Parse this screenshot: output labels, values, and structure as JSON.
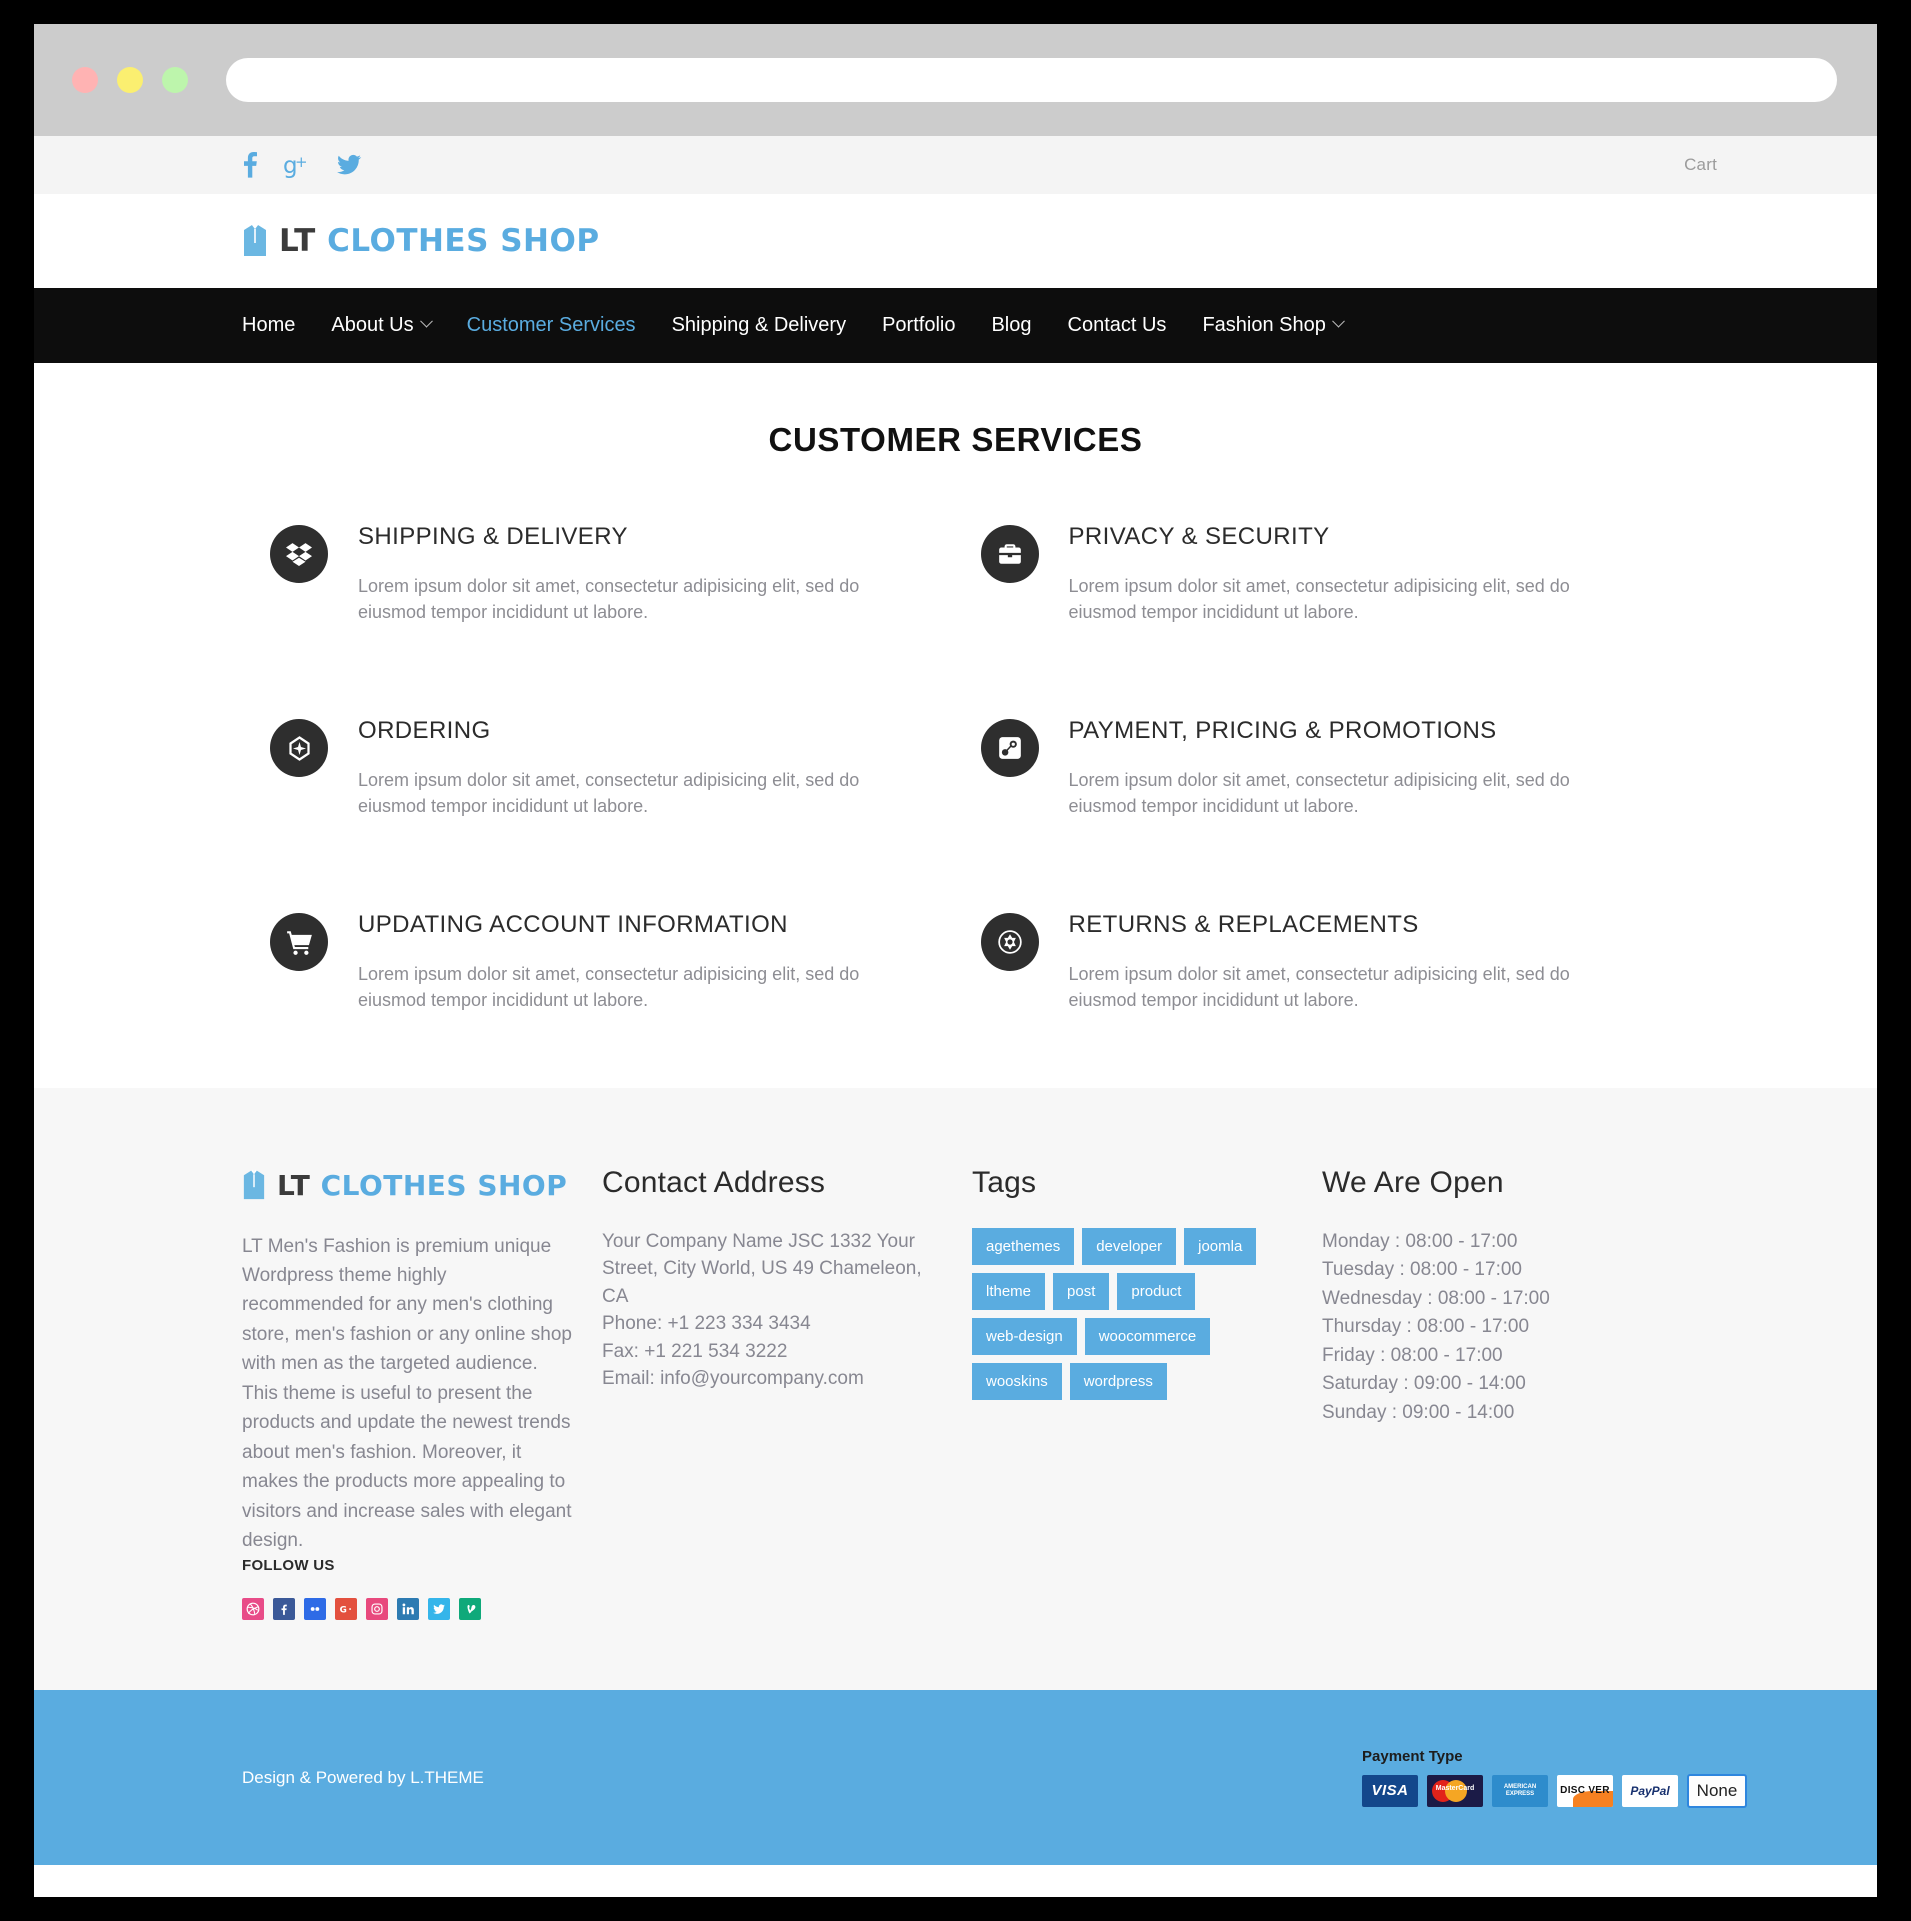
{
  "browser": {
    "url_value": "",
    "url_placeholder": "",
    "dots": [
      "close",
      "minimize",
      "maximize"
    ]
  },
  "topbar": {
    "social": [
      {
        "name": "facebook-icon",
        "label": "Facebook"
      },
      {
        "name": "google-plus-icon",
        "label": "Google Plus"
      },
      {
        "name": "twitter-icon",
        "label": "Twitter"
      }
    ],
    "cart_label": "Cart"
  },
  "header": {
    "logo": {
      "lt": "LT",
      "rest": "CLOTHES SHOP",
      "icon": "suit-icon"
    }
  },
  "nav": {
    "items": [
      {
        "label": "Home",
        "active": false,
        "caret": false
      },
      {
        "label": "About Us",
        "active": false,
        "caret": true
      },
      {
        "label": "Customer Services",
        "active": true,
        "caret": false
      },
      {
        "label": "Shipping & Delivery",
        "active": false,
        "caret": false
      },
      {
        "label": "Portfolio",
        "active": false,
        "caret": false
      },
      {
        "label": "Blog",
        "active": false,
        "caret": false
      },
      {
        "label": "Contact Us",
        "active": false,
        "caret": false
      },
      {
        "label": "Fashion Shop",
        "active": false,
        "caret": true
      }
    ]
  },
  "main": {
    "page_title": "CUSTOMER SERVICES",
    "services": [
      {
        "title": "SHIPPING & DELIVERY",
        "icon": "dropbox-icon",
        "desc": "Lorem ipsum dolor sit amet, consectetur adipisicing elit, sed do eiusmod tempor incididunt ut labore."
      },
      {
        "title": "PRIVACY & SECURITY",
        "icon": "briefcase-icon",
        "desc": "Lorem ipsum dolor sit amet, consectetur adipisicing elit, sed do eiusmod tempor incididunt ut labore."
      },
      {
        "title": "ORDERING",
        "icon": "gem-icon",
        "desc": "Lorem ipsum dolor sit amet, consectetur adipisicing elit, sed do eiusmod tempor incididunt ut labore."
      },
      {
        "title": "PAYMENT, PRICING & PROMOTIONS",
        "icon": "steam-icon",
        "desc": "Lorem ipsum dolor sit amet, consectetur adipisicing elit, sed do eiusmod tempor incididunt ut labore."
      },
      {
        "title": "UPDATING ACCOUNT INFORMATION",
        "icon": "shopping-cart-icon",
        "desc": "Lorem ipsum dolor sit amet, consectetur adipisicing elit, sed do eiusmod tempor incididunt ut labore."
      },
      {
        "title": "RETURNS & REPLACEMENTS",
        "icon": "empire-icon",
        "desc": "Lorem ipsum dolor sit amet, consectetur adipisicing elit, sed do eiusmod tempor incididunt ut labore."
      }
    ]
  },
  "footer": {
    "about": {
      "logo": {
        "lt": "LT",
        "rest": "CLOTHES SHOP",
        "icon": "suit-icon"
      },
      "text": "LT Men's Fashion is premium unique Wordpress theme highly recommended for any men's clothing store, men's fashion or any online shop with men as the targeted audience. This theme is useful to present the products and update the newest trends about men's fashion. Moreover, it makes the products more appealing to visitors and increase sales with elegant design.",
      "follow_label": "FOLLOW US",
      "socials": [
        {
          "name": "dribbble-icon",
          "color": "#e84c88"
        },
        {
          "name": "facebook-icon",
          "color": "#3b5998"
        },
        {
          "name": "flickr-icon",
          "color": "#2e6be6"
        },
        {
          "name": "google-plus-icon",
          "color": "#e3503e"
        },
        {
          "name": "instagram-icon",
          "color": "#e8497d"
        },
        {
          "name": "linkedin-icon",
          "color": "#2d7bb2"
        },
        {
          "name": "twitter-icon",
          "color": "#35b5ea"
        },
        {
          "name": "vine-icon",
          "color": "#0fa97a"
        }
      ]
    },
    "contact": {
      "heading": "Contact Address",
      "lines": [
        "Your Company Name JSC 1332 Your Street, City World, US 49 Chameleon, CA",
        "Phone: +1 223 334 3434",
        "Fax: +1 221 534 3222",
        "Email: info@yourcompany.com"
      ]
    },
    "tags": {
      "heading": "Tags",
      "items": [
        "agethemes",
        "developer",
        "joomla",
        "ltheme",
        "post",
        "product",
        "web-design",
        "woocommerce",
        "wooskins",
        "wordpress"
      ]
    },
    "hours": {
      "heading": "We Are Open",
      "lines": [
        "Monday : 08:00 - 17:00",
        "Tuesday : 08:00 - 17:00",
        "Wednesday : 08:00 - 17:00",
        "Thursday : 08:00 - 17:00",
        "Friday : 08:00 - 17:00",
        "Saturday : 09:00 - 14:00",
        "Sunday : 09:00 - 14:00"
      ]
    }
  },
  "bottombar": {
    "copyright": "Design & Powered by L.THEME",
    "payment_label": "Payment Type",
    "payments": [
      {
        "name": "visa-icon",
        "label": "VISA"
      },
      {
        "name": "mastercard-icon",
        "label": "MasterCard"
      },
      {
        "name": "amex-icon",
        "label": "AMERICAN EXPRESS"
      },
      {
        "name": "discover-icon",
        "label": "DISC VER"
      },
      {
        "name": "paypal-icon",
        "label": "PayPal"
      },
      {
        "name": "none-option",
        "label": "None"
      }
    ]
  },
  "colors": {
    "accent": "#5aace0",
    "nav_bg": "#0d0d0d",
    "footer_bg": "#f7f7f7",
    "icon_circle": "#2e2e2e"
  }
}
